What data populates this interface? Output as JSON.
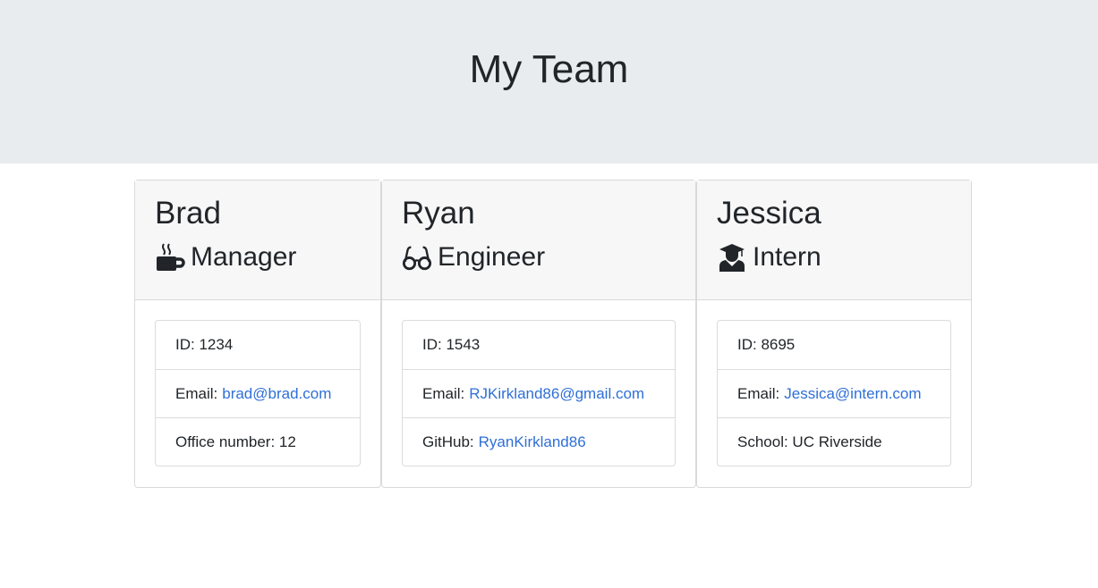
{
  "header": {
    "title": "My Team"
  },
  "colors": {
    "jumbotron_bg": "#e9ecef",
    "link": "#2f6fd6",
    "card_header_bg": "#f7f7f7"
  },
  "employees": [
    {
      "name": "Brad",
      "role": "Manager",
      "role_icon": "coffee-mug-icon",
      "id_label": "ID: 1234",
      "email_label": "Email:",
      "email": "brad@brad.com",
      "extra_label": "Office number: 12",
      "extra_link": ""
    },
    {
      "name": "Ryan",
      "role": "Engineer",
      "role_icon": "glasses-icon",
      "id_label": "ID: 1543",
      "email_label": "Email:",
      "email": "RJKirkland86@gmail.com",
      "extra_label": "GitHub:",
      "extra_link": "RyanKirkland86"
    },
    {
      "name": "Jessica",
      "role": "Intern",
      "role_icon": "graduate-icon",
      "id_label": "ID: 8695",
      "email_label": "Email:",
      "email": "Jessica@intern.com",
      "extra_label": "School: UC Riverside",
      "extra_link": ""
    }
  ]
}
